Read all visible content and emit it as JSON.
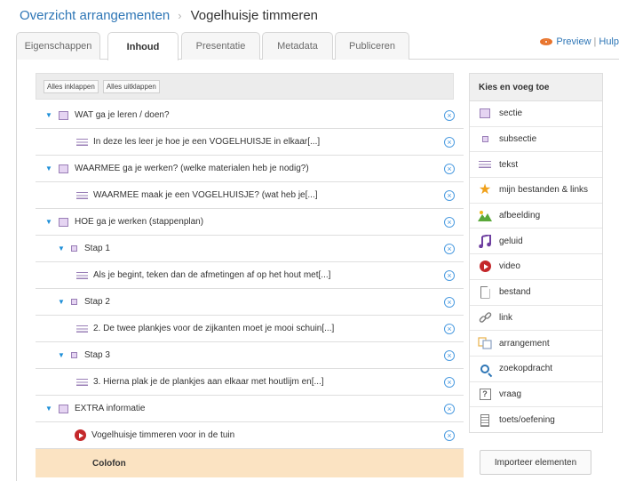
{
  "breadcrumb": {
    "parent": "Overzicht arrangementen",
    "separator": "›",
    "current": "Vogelhuisje timmeren"
  },
  "tabs": [
    {
      "label": "Eigenschappen",
      "active": false
    },
    {
      "label": "Inhoud",
      "active": true
    },
    {
      "label": "Presentatie",
      "active": false
    },
    {
      "label": "Metadata",
      "active": false
    },
    {
      "label": "Publiceren",
      "active": false
    }
  ],
  "top_links": {
    "preview": "Preview",
    "separator": "|",
    "help": "Hulp"
  },
  "toolbar": {
    "collapse_all": "Alles inklappen",
    "expand_all": "Alles uitklappen"
  },
  "tree": [
    {
      "type": "sectie",
      "label": "WAT ga je leren / doen?"
    },
    {
      "type": "tekst",
      "label": "In deze les leer je hoe je een VOGELHUISJE in elkaar[...]"
    },
    {
      "type": "sectie",
      "label": "WAARMEE ga je werken? (welke materialen heb je nodig?)"
    },
    {
      "type": "tekst",
      "label": "WAARMEE maak je een VOGELHUISJE? (wat heb je[...]"
    },
    {
      "type": "sectie",
      "label": "HOE ga je werken (stappenplan)"
    },
    {
      "type": "subsectie",
      "label": "Stap 1"
    },
    {
      "type": "tekst",
      "label": "Als je begint, teken dan de afmetingen af op het hout met[...]"
    },
    {
      "type": "subsectie",
      "label": "Stap 2"
    },
    {
      "type": "tekst",
      "label": "2. De twee plankjes voor de zijkanten moet je mooi schuin[...]"
    },
    {
      "type": "subsectie",
      "label": "Stap 3"
    },
    {
      "type": "tekst",
      "label": "3. Hierna plak je de plankjes aan elkaar met houtlijm en[...]"
    },
    {
      "type": "sectie",
      "label": "EXTRA informatie"
    },
    {
      "type": "video",
      "label": "Vogelhuisje timmeren voor in de tuin"
    }
  ],
  "colofon": "Colofon",
  "sidebar": {
    "title": "Kies en voeg toe",
    "items": [
      {
        "label": "sectie",
        "icon": "sectie-icon"
      },
      {
        "label": "subsectie",
        "icon": "subsectie-icon"
      },
      {
        "label": "tekst",
        "icon": "text-lines-icon"
      },
      {
        "label": "mijn bestanden & links",
        "icon": "star-icon"
      },
      {
        "label": "afbeelding",
        "icon": "image-icon"
      },
      {
        "label": "geluid",
        "icon": "music-note-icon"
      },
      {
        "label": "video",
        "icon": "video-play-icon"
      },
      {
        "label": "bestand",
        "icon": "file-icon"
      },
      {
        "label": "link",
        "icon": "link-chain-icon"
      },
      {
        "label": "arrangement",
        "icon": "arrangement-icon"
      },
      {
        "label": "zoekopdracht",
        "icon": "search-icon"
      },
      {
        "label": "vraag",
        "icon": "question-icon"
      },
      {
        "label": "toets/oefening",
        "icon": "test-icon"
      }
    ]
  },
  "import_button": "Importeer elementen",
  "colors": {
    "link": "#2e76b6",
    "accent_toggle": "#1e8fd8",
    "colofon_bg": "#fbe3c2",
    "video_red": "#c4282b",
    "purple": "#9a7fb7"
  }
}
